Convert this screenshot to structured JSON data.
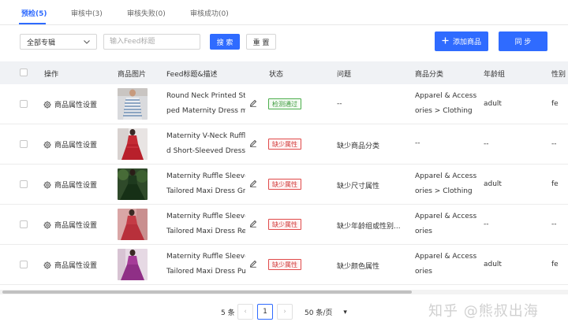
{
  "tabs": [
    {
      "label": "预检(5)"
    },
    {
      "label": "审核中(3)"
    },
    {
      "label": "审核失败(0)"
    },
    {
      "label": "审核成功(0)"
    }
  ],
  "filters": {
    "album_select": "全部专辑",
    "search_placeholder": "输入Feed标题",
    "search_label": "搜 索",
    "reset_label": "重 置"
  },
  "actions": {
    "add_label": "添加商品",
    "sync_label": "同 步"
  },
  "columns": [
    "操作",
    "商品图片",
    "Feed标题&描述",
    "状态",
    "问题",
    "商品分类",
    "年龄组",
    "性别"
  ],
  "rows": [
    {
      "op": "商品属性设置",
      "title1": "Round Neck Printed Stri",
      "title2": "ped Maternity Dress m...",
      "status": "检测通过",
      "issue": "--",
      "cat1": "Apparel & Access",
      "cat2": "ories > Clothing",
      "age": "adult",
      "gender": "fe"
    },
    {
      "op": "商品属性设置",
      "title1": "Maternity V-Neck Ruffle",
      "title2": "d Short-Sleeved Dress...",
      "status": "缺少属性",
      "issue": "缺少商品分类",
      "cat1": "--",
      "cat2": "",
      "age": "--",
      "gender": "--"
    },
    {
      "op": "商品属性设置",
      "title1": "Maternity Ruffle Sleeve",
      "title2": "Tailored Maxi Dress Gr...",
      "status": "缺少属性",
      "issue": "缺少尺寸属性",
      "cat1": "Apparel & Access",
      "cat2": "ories > Clothing",
      "age": "adult",
      "gender": "fe"
    },
    {
      "op": "商品属性设置",
      "title1": "Maternity Ruffle Sleeve",
      "title2": "Tailored Maxi Dress Re...",
      "status": "缺少属性",
      "issue": "缺少年龄组或性别...",
      "cat1": "Apparel & Access",
      "cat2": "ories",
      "age": "--",
      "gender": "--"
    },
    {
      "op": "商品属性设置",
      "title1": "Maternity Ruffle Sleeve",
      "title2": "Tailored Maxi Dress Pu...",
      "status": "缺少属性",
      "issue": "缺少颜色属性",
      "cat1": "Apparel & Access",
      "cat2": "ories",
      "age": "adult",
      "gender": "fe"
    }
  ],
  "pagination": {
    "total": "5 条",
    "prev": "‹",
    "current": "1",
    "next": "›",
    "page_size": "50 条/页",
    "page_size_caret": "▾"
  },
  "watermark": "知乎 @熊叔出海",
  "colors": {
    "primary": "#2f6bff",
    "success": "#3c9a3c",
    "danger": "#d23c3c",
    "header_bg": "#f0f2f5"
  }
}
